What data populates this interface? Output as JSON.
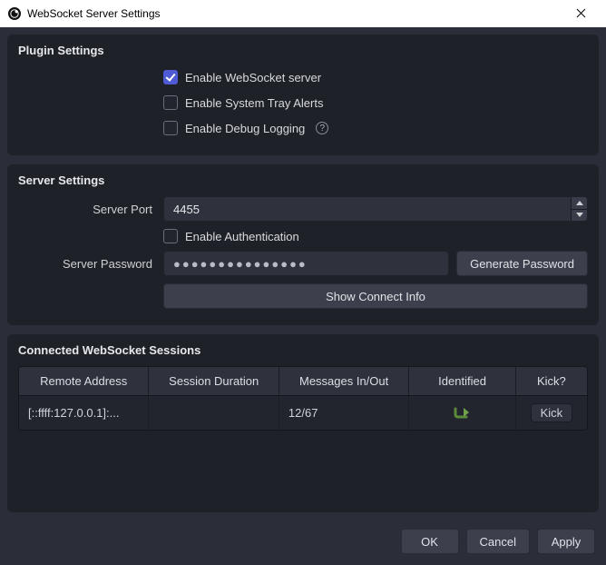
{
  "window": {
    "title": "WebSocket Server Settings"
  },
  "plugin": {
    "heading": "Plugin Settings",
    "enable_server": {
      "label": "Enable WebSocket server",
      "checked": true
    },
    "enable_tray": {
      "label": "Enable System Tray Alerts",
      "checked": false
    },
    "enable_debug": {
      "label": "Enable Debug Logging",
      "checked": false
    }
  },
  "server": {
    "heading": "Server Settings",
    "port_label": "Server Port",
    "port_value": "4455",
    "enable_auth": {
      "label": "Enable Authentication",
      "checked": false
    },
    "password_label": "Server Password",
    "password_mask": "●●●●●●●●●●●●●●●",
    "generate_btn": "Generate Password",
    "show_connect_btn": "Show Connect Info"
  },
  "sessions": {
    "heading": "Connected WebSocket Sessions",
    "columns": {
      "remote": "Remote Address",
      "duration": "Session Duration",
      "messages": "Messages In/Out",
      "identified": "Identified",
      "kick": "Kick?"
    },
    "rows": [
      {
        "remote": "[::ffff:127.0.0.1]:...",
        "duration": "",
        "messages": "12/67",
        "identified": true,
        "kick_label": "Kick"
      }
    ]
  },
  "footer": {
    "ok": "OK",
    "cancel": "Cancel",
    "apply": "Apply"
  }
}
